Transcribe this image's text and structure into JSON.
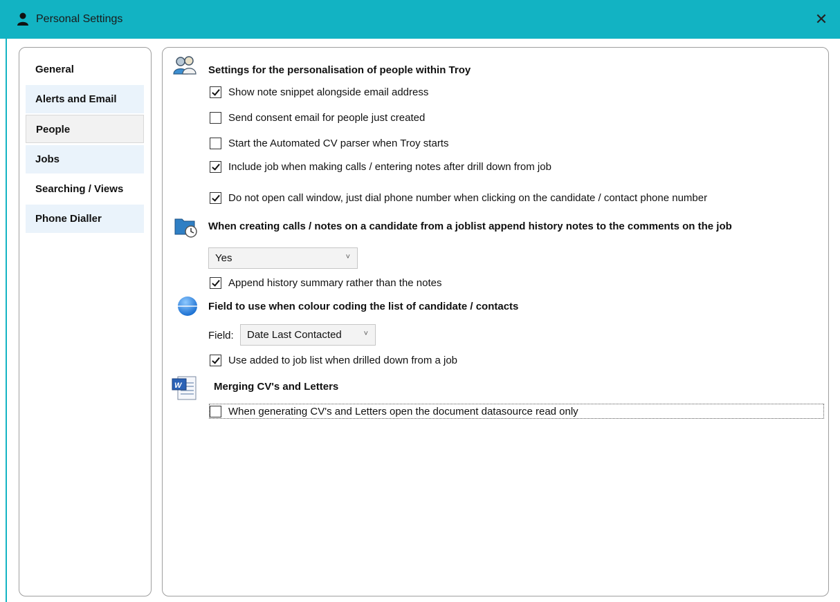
{
  "window": {
    "title": "Personal Settings",
    "title_icon": "person-icon",
    "close_glyph": "✕"
  },
  "sidebar": {
    "items": [
      {
        "label": "General"
      },
      {
        "label": "Alerts and Email"
      },
      {
        "label": "People"
      },
      {
        "label": "Jobs"
      },
      {
        "label": "Searching / Views"
      },
      {
        "label": "Phone Dialler"
      }
    ],
    "selected": "People"
  },
  "sections": {
    "people": {
      "heading": "Settings for the personalisation of people within Troy",
      "icon": "people-icon",
      "options": [
        {
          "label": "Show note snippet alongside email address",
          "checked": true
        },
        {
          "label": "Send consent email for people just created",
          "checked": false
        },
        {
          "label": "Start the Automated CV parser when Troy starts",
          "checked": false
        },
        {
          "label": "Include job when making calls / entering notes after drill down from job",
          "checked": true
        },
        {
          "label": "Do not open call window, just dial phone number when clicking on the candidate / contact phone number",
          "checked": true
        }
      ]
    },
    "joblist": {
      "heading": "When creating calls / notes on a candidate from a joblist append history notes to the comments on the job",
      "icon": "folder-clock-icon",
      "dropdown_value": "Yes",
      "option": {
        "label": "Append history summary rather than the notes",
        "checked": true
      }
    },
    "colour": {
      "heading": "Field to use when colour coding the list of candidate / contacts",
      "icon": "blue-circle-icon",
      "field_label": "Field:",
      "field_value": "Date Last Contacted",
      "option": {
        "label": "Use added to job list when drilled down from a job",
        "checked": true
      }
    },
    "merging": {
      "heading": "Merging CV's and Letters",
      "icon": "word-document-icon",
      "option": {
        "label": "When generating CV's and Letters open the document datasource read only",
        "checked": false
      }
    }
  },
  "colors": {
    "titlebar": "#12b3c3",
    "nav_light": "#eaf3fb",
    "nav_selected": "#f2f2f2"
  }
}
